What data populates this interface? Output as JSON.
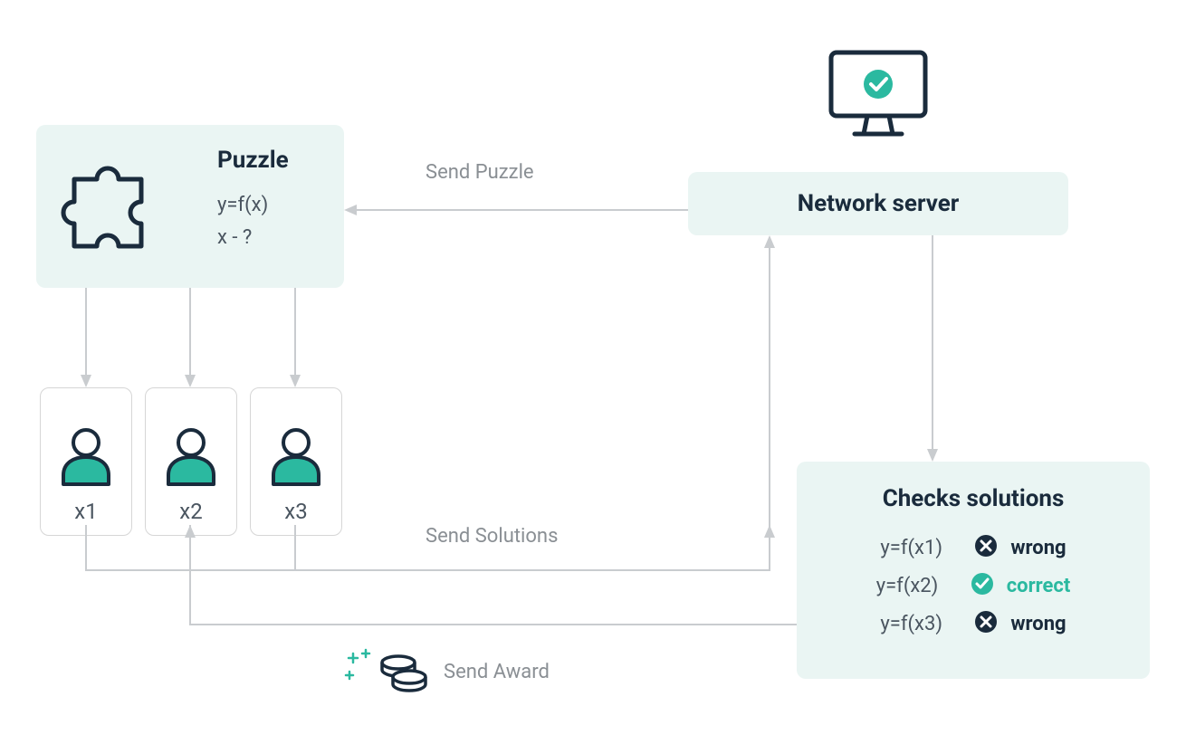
{
  "puzzle": {
    "title": "Puzzle",
    "eq1": "y=f(x)",
    "eq2": "x - ?"
  },
  "server": {
    "title": "Network server"
  },
  "arrows": {
    "send_puzzle": "Send Puzzle",
    "send_solutions": "Send Solutions",
    "send_award": "Send Award"
  },
  "people": [
    {
      "label": "x1"
    },
    {
      "label": "x2"
    },
    {
      "label": "x3"
    }
  ],
  "checks": {
    "title": "Checks solutions",
    "rows": [
      {
        "eq": "y=f(x1)",
        "result": "wrong",
        "ok": false
      },
      {
        "eq": "y=f(x2)",
        "result": "correct",
        "ok": true
      },
      {
        "eq": "y=f(x3)",
        "result": "wrong",
        "ok": false
      }
    ]
  },
  "colors": {
    "dark": "#1a2b3c",
    "teal": "#2bb9a0",
    "gray": "#8a8f94",
    "boxbg": "#eaf5f3"
  }
}
